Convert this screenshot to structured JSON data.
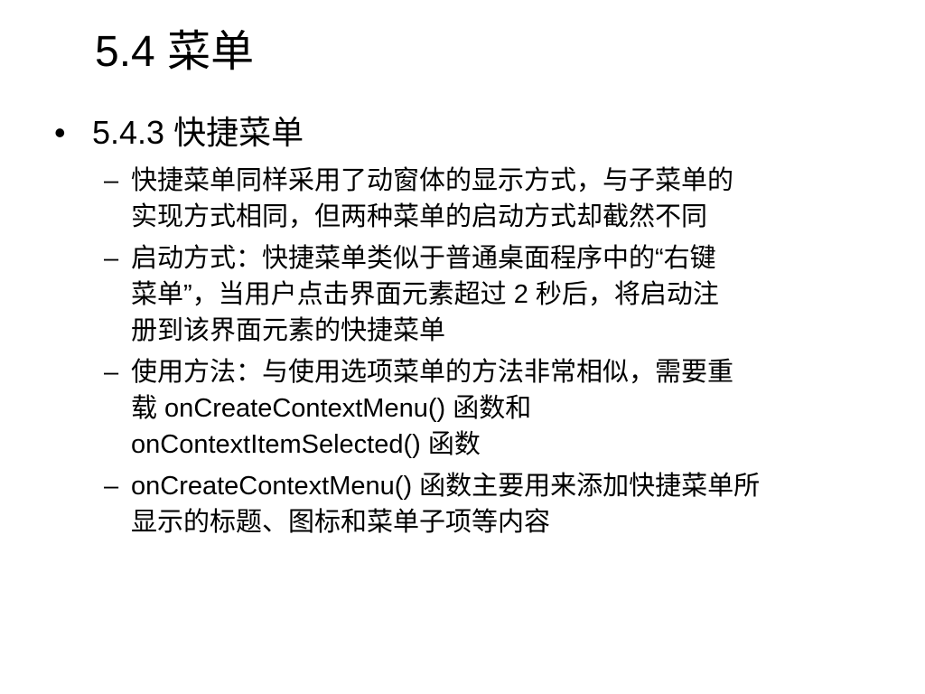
{
  "slide": {
    "title": "5.4  菜单",
    "section": {
      "bullet": "•",
      "label": "5.4.3  快捷菜单"
    },
    "items": [
      {
        "marker": "–",
        "text": "快捷菜单同样采用了动窗体的显示方式，与子菜单的\n实现方式相同，但两种菜单的启动方式却截然不同"
      },
      {
        "marker": "–",
        "text": "启动方式：快捷菜单类似于普通桌面程序中的“右键\n菜单”，当用户点击界面元素超过 2 秒后，将启动注\n册到该界面元素的快捷菜单"
      },
      {
        "marker": "–",
        "text": "使用方法：与使用选项菜单的方法非常相似，需要重\n载 onCreateContextMenu() 函数和\nonContextItemSelected() 函数"
      },
      {
        "marker": "–",
        "text": "onCreateContextMenu() 函数主要用来添加快捷菜单所\n显示的标题、图标和菜单子项等内容"
      }
    ]
  }
}
